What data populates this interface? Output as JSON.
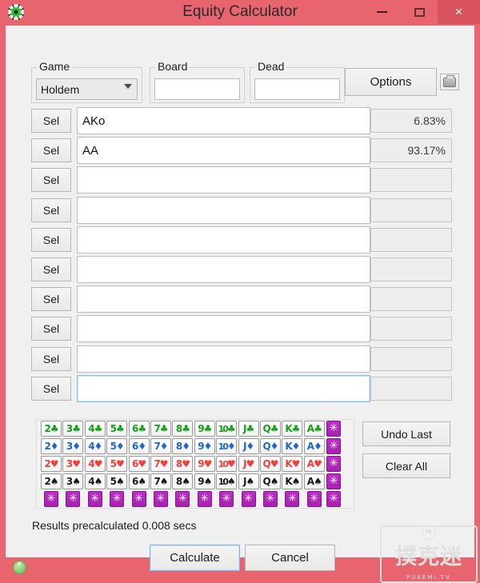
{
  "window": {
    "title": "Equity Calculator",
    "app_icon": "poker-chip-icon",
    "minimize_label": "–",
    "maximize_label": "□",
    "close_label": "×",
    "titlebar_color": "#e8656f",
    "close_color": "#d8535d"
  },
  "toolbar": {
    "game": {
      "legend": "Game",
      "selected": "Holdem",
      "options": [
        "Holdem"
      ]
    },
    "board": {
      "legend": "Board",
      "value": "",
      "placeholder": ""
    },
    "dead": {
      "legend": "Dead",
      "value": "",
      "placeholder": ""
    },
    "options_label": "Options",
    "print_icon": "printer-icon"
  },
  "hand_rows": [
    {
      "sel_label": "Sel",
      "hand": "AKo",
      "equity": "6.83%",
      "focused": false
    },
    {
      "sel_label": "Sel",
      "hand": "AA",
      "equity": "93.17%",
      "focused": false
    },
    {
      "sel_label": "Sel",
      "hand": "",
      "equity": "",
      "focused": false
    },
    {
      "sel_label": "Sel",
      "hand": "",
      "equity": "",
      "focused": false
    },
    {
      "sel_label": "Sel",
      "hand": "",
      "equity": "",
      "focused": false
    },
    {
      "sel_label": "Sel",
      "hand": "",
      "equity": "",
      "focused": false
    },
    {
      "sel_label": "Sel",
      "hand": "",
      "equity": "",
      "focused": false
    },
    {
      "sel_label": "Sel",
      "hand": "",
      "equity": "",
      "focused": false
    },
    {
      "sel_label": "Sel",
      "hand": "",
      "equity": "",
      "focused": false
    },
    {
      "sel_label": "Sel",
      "hand": "",
      "equity": "",
      "focused": true
    }
  ],
  "card_grid": {
    "ranks": [
      "2",
      "3",
      "4",
      "5",
      "6",
      "7",
      "8",
      "9",
      "10",
      "J",
      "Q",
      "K",
      "A"
    ],
    "suits": [
      {
        "key": "c",
        "symbol": "♣",
        "name": "clubs",
        "color": "#16a016"
      },
      {
        "key": "d",
        "symbol": "♦",
        "name": "diamonds",
        "color": "#1f66d0"
      },
      {
        "key": "h",
        "symbol": "♥",
        "name": "hearts",
        "color": "#f0403e"
      },
      {
        "key": "s",
        "symbol": "♠",
        "name": "spades",
        "color": "#1b1b1b"
      }
    ],
    "wildcard_symbol": "✳",
    "wildcard_color": "#bb2ec4",
    "wildcard_column_count": 4,
    "wildcard_bottom_row_count": 14
  },
  "side_buttons": {
    "undo_label": "Undo Last",
    "clear_label": "Clear All"
  },
  "footer": {
    "status": "Results precalculated 0.008 secs",
    "calculate_label": "Calculate",
    "cancel_label": "Cancel",
    "info_icon": "info-dot-icon",
    "watermark_text": "撲克迷",
    "watermark_sub": "PUKEMI.TV",
    "watermark_top": "M"
  }
}
